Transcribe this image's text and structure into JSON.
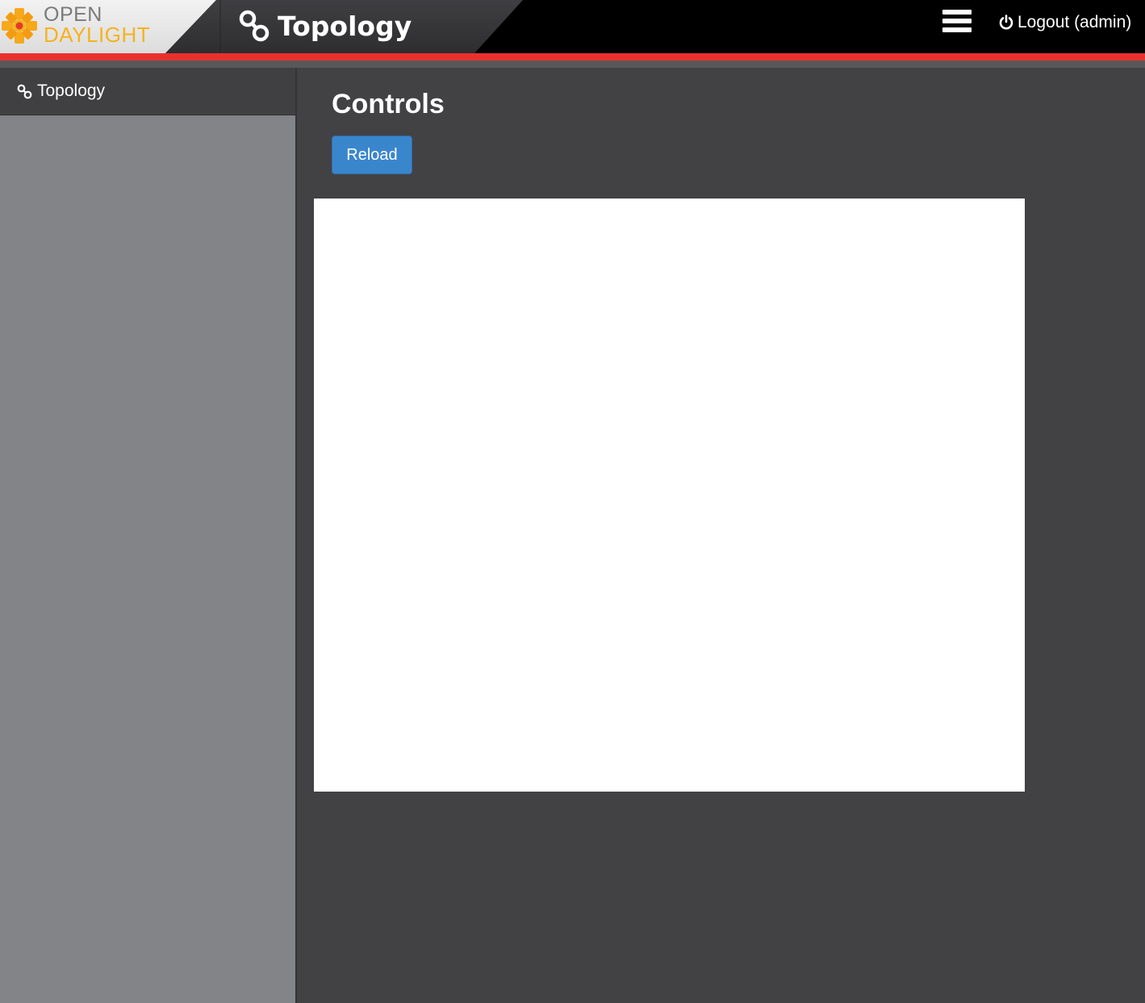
{
  "header": {
    "logo": {
      "line1": "OPEN",
      "line2": "DAYLIGHT",
      "icon": "opendaylight-flower-icon"
    },
    "app_title": "Topology",
    "app_icon": "topology-link-icon",
    "menu_icon": "hamburger-menu-icon",
    "logout_label": "Logout (admin)",
    "logout_icon": "power-icon"
  },
  "colors": {
    "accent_red": "#e8312f",
    "button_blue": "#3a86cc",
    "logo_orange": "#f6b21c",
    "sidebar_bg": "#838487",
    "main_bg": "#424244"
  },
  "sidebar": {
    "items": [
      {
        "label": "Topology",
        "icon": "link-icon"
      }
    ]
  },
  "main": {
    "section_title": "Controls",
    "reload_label": "Reload"
  }
}
